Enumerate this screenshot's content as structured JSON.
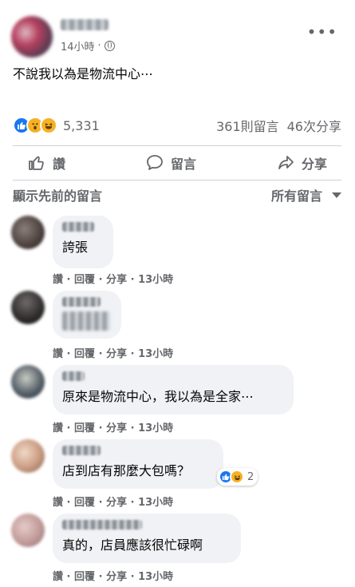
{
  "post": {
    "time": "14小時",
    "text": "不說我以為是物流中心⋯",
    "more": "•••",
    "reactions": {
      "count": "5,331",
      "comments": "361則留言",
      "shares": "46次分享"
    },
    "actions": {
      "like": "讚",
      "comment": "留言",
      "share": "分享"
    },
    "view_previous": "顯示先前的留言",
    "all_comments": "所有留言"
  },
  "comments": [
    {
      "text": "誇張",
      "like": "讚",
      "reply": "回覆",
      "share": "分享",
      "time": "13小時",
      "sep": "·"
    },
    {
      "text": "",
      "like": "讚",
      "reply": "回覆",
      "share": "分享",
      "time": "13小時",
      "sep": "·"
    },
    {
      "text": "原來是物流中心，我以為是全家⋯",
      "like": "讚",
      "reply": "回覆",
      "share": "分享",
      "time": "13小時",
      "sep": "·"
    },
    {
      "text": "店到店有那麼大包嗎？",
      "like": "讚",
      "reply": "回覆",
      "share": "分享",
      "time": "13小時",
      "sep": "·",
      "reaction_count": "2"
    },
    {
      "text": "真的，店員應該很忙碌啊",
      "like": "讚",
      "reply": "回覆",
      "share": "分享",
      "time": "13小時",
      "sep": "·"
    }
  ],
  "icons": {
    "like": "like-reaction-icon",
    "wow": "wow-reaction-icon",
    "haha": "haha-reaction-icon"
  },
  "colors": {
    "like_blue": "#1877f2",
    "muted": "#65676b",
    "bubble": "#f0f2f5"
  }
}
